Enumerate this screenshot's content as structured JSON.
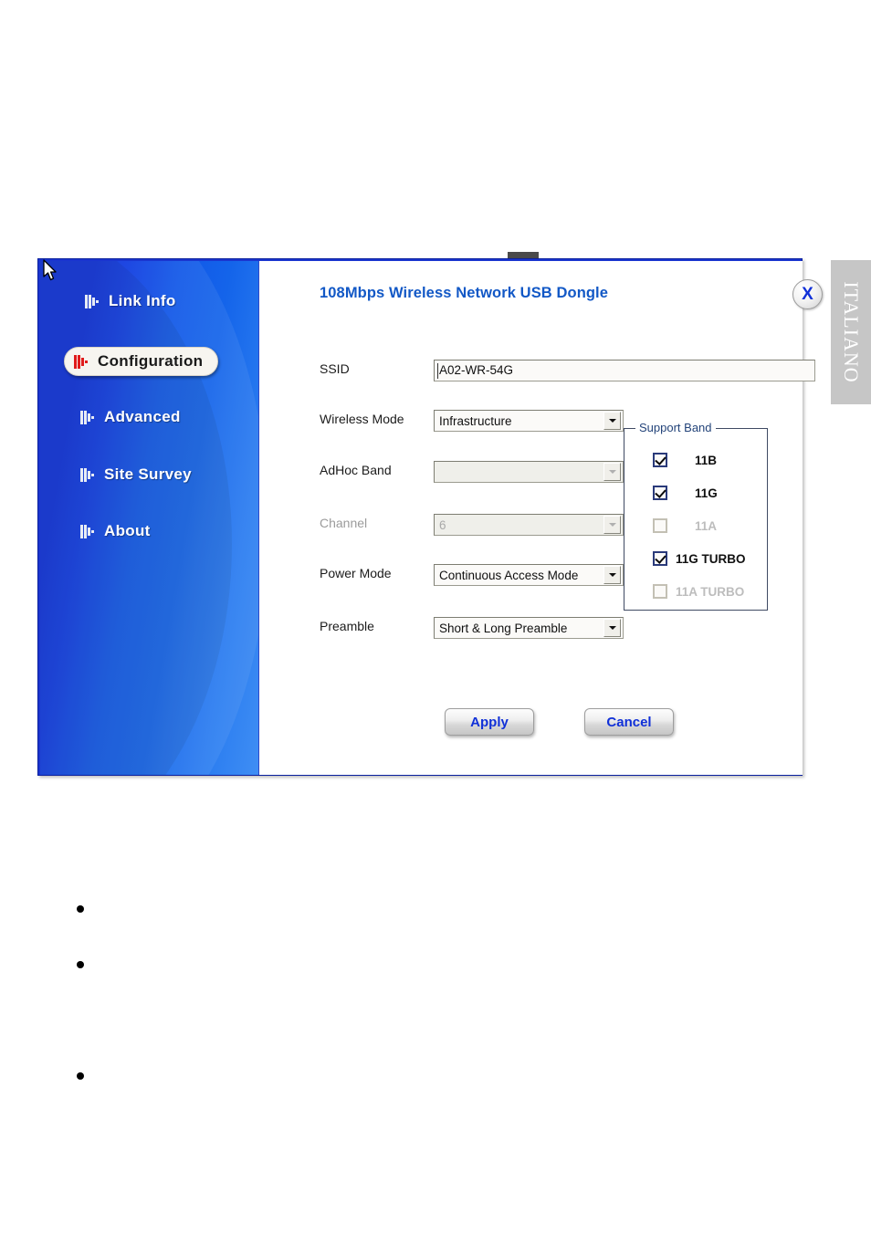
{
  "page": {
    "language_tab": "ITALIANO",
    "bullets": [
      "",
      "",
      ""
    ]
  },
  "window": {
    "panel_title": "108Mbps Wireless Network USB Dongle",
    "close_label": "X",
    "accent_blue": "#1258c6",
    "window_border_blue": "#1a35cf",
    "button_text_blue": "#1030d8"
  },
  "sidebar": {
    "items": [
      {
        "label": "Link Info",
        "active": false,
        "icon": "dotted-triangle-icon"
      },
      {
        "label": "Configuration",
        "active": true,
        "icon": "dotted-triangle-icon"
      },
      {
        "label": "Advanced",
        "active": false,
        "icon": "dotted-triangle-icon"
      },
      {
        "label": "Site Survey",
        "active": false,
        "icon": "dotted-triangle-icon"
      },
      {
        "label": "About",
        "active": false,
        "icon": "dotted-triangle-icon"
      }
    ]
  },
  "form": {
    "ssid": {
      "label": "SSID",
      "value": "A02-WR-54G",
      "placeholder": ""
    },
    "wireless_mode": {
      "label": "Wireless Mode",
      "value": "Infrastructure",
      "enabled": true
    },
    "adhoc_band": {
      "label": "AdHoc Band",
      "value": "",
      "enabled": false
    },
    "channel": {
      "label": "Channel",
      "value": "6",
      "enabled": false
    },
    "power_mode": {
      "label": "Power Mode",
      "value": "Continuous Access Mode",
      "enabled": true
    },
    "preamble": {
      "label": "Preamble",
      "value": "Short & Long Preamble",
      "enabled": true
    }
  },
  "support_band": {
    "legend": "Support Band",
    "options": [
      {
        "label": "11B",
        "checked": true,
        "enabled": true
      },
      {
        "label": "11G",
        "checked": true,
        "enabled": true
      },
      {
        "label": "11A",
        "checked": false,
        "enabled": true
      },
      {
        "label": "11G TURBO",
        "checked": true,
        "enabled": true
      },
      {
        "label": "11A TURBO",
        "checked": false,
        "enabled": false
      }
    ]
  },
  "actions": {
    "apply_label": "Apply",
    "cancel_label": "Cancel"
  }
}
